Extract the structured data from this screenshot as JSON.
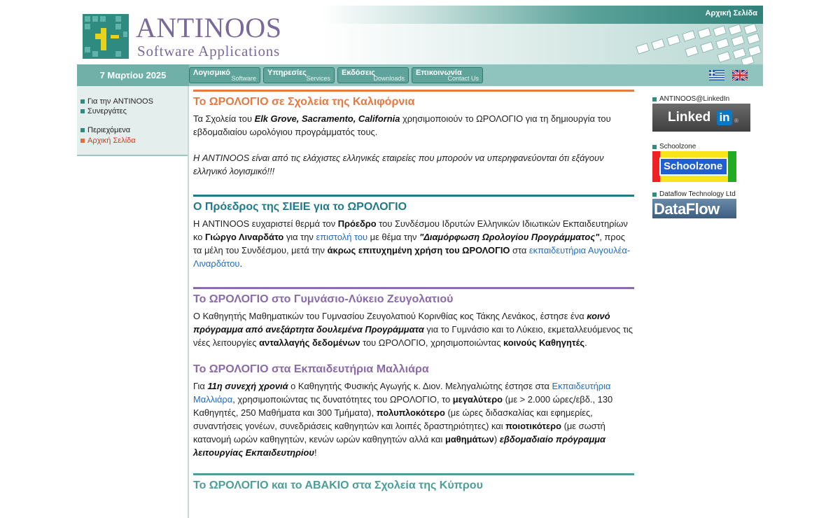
{
  "header": {
    "brand_name": "ANTINOOS",
    "brand_sub": "Software Applications",
    "home_link": "Αρχική Σελίδα"
  },
  "nav": {
    "date": "7 Μαρτίου 2025",
    "items": [
      {
        "gr": "Λογισμικό",
        "en": "Software"
      },
      {
        "gr": "Υπηρεσίες",
        "en": "Services"
      },
      {
        "gr": "Εκδόσεις",
        "en": "Downloads"
      },
      {
        "gr": "Επικοινωνία",
        "en": "Contact Us"
      }
    ]
  },
  "sidebar": {
    "items": [
      {
        "label": "Για την ANTINOOS"
      },
      {
        "label": "Συνεργάτες"
      },
      {
        "label": "Περιεχόμενα"
      },
      {
        "label": "Αρχική Σελίδα"
      }
    ]
  },
  "colors": {
    "orange": "#e37a42",
    "teal_dark": "#1f7a8c",
    "purple": "#8a6aa8",
    "teal": "#4d9e98"
  },
  "sections": {
    "s1": {
      "title": "Το ΩΡΟΛΟΓΙΟ σε Σχολεία της Καλιφόρνια",
      "p1_a": "Τα Σχολεία του ",
      "p1_b": "Elk Grove, Sacramento, California",
      "p1_c": " χρησιμοποιούν το ΩΡΟΛΟΓΙΟ για τη δημιουργία του εβδομαδιαίου ωρολόγιου προγράμματός τους.",
      "p2": "Η ANTINOOS είναι από τις ελάχιστες ελληνικές εταιρείες που μπορούν να υπερηφανεύονται ότι εξάγουν ελληνικό λογισμικό!!!"
    },
    "s2": {
      "title": "Ο Πρόεδρος της ΣΙΕΙΕ για το ΩΡΟΛΟΓΙΟ",
      "a": "Η ANTINOOS ευχαριστεί θερμά τον ",
      "b": "Πρόεδρο",
      "c": " του Συνδέσμου Ιδρυτών Ελληνικών Ιδιωτικών Εκπαιδευτηρίων κο ",
      "d": "Γιώργο Λιναρδάτο",
      "e": " για την ",
      "f": "επιστολή του",
      "g": " με θέμα την ",
      "h": "\"Διαμόρφωση Ωρολογίου Προγράμματος\"",
      "i": ", προς τα μέλη του Συνδέσμου, μετά την ",
      "j": "άκρως επιτυχημένη χρήση του ΩΡΟΛΟΓΙΟ",
      "k": " στα ",
      "l": "εκπαιδευτήρια Αυγουλέα-Λιναρδάτου",
      "m": "."
    },
    "s3": {
      "title": "Το ΩΡΟΛΟΓΙΟ στο Γυμνάσιο-Λύκειο Ζευγολατιού",
      "a": "Ο Καθηγητής Μαθηματικών του Γυμνασίου Ζευγολατιού Κορινθίας κος Τάκης Λενάκος, έστησε ένα ",
      "b": "κοινό πρόγραμμα από ανεξάρτητα δουλεμένα Προγράμματα",
      "c": " για το Γυμνάσιο και το Λύκειο, εκμεταλλευόμενος τις νέες λειτουργίες ",
      "d": "ανταλλαγής δεδομένων",
      "e": " του ΩΡΟΛΟΓΙΟ, χρησιμοποιώντας ",
      "f": "κοινούς Καθηγητές",
      "g": "."
    },
    "s4": {
      "title": "Το ΩΡΟΛΟΓΙΟ στα Εκπαιδευτήρια Μαλλιάρα",
      "a": "Για ",
      "b": "11η συνεχή χρονιά",
      "c": " ο Καθηγητής Φυσικής Αγωγής κ. Διον. Μεληγαλιώτης έστησε στα ",
      "d": "Εκπαιδευτήρια Μαλλιάρα",
      "e": ", χρησιμοποιώντας τις δυνατότητες του ΩΡΟΛΟΓΙΟ, το ",
      "f": "μεγαλύτερο",
      "g": " (με > 2.000 ώρες/εβδ., 130 Καθηγητές, 250 Μαθήματα και 300 Τμήματα), ",
      "h": "πολυπλοκότερο",
      "i": " (με ώρες διδασκαλίας και εφημερίες, συναντήσεις γονέων, συνεδριάσεις καθηγητών και λοιπές δραστηριότητες) και ",
      "j": "ποιοτικότερο",
      "k": " (με σωστή κατανομή ωρών καθηγητών, κενών ωρών καθηγητών αλλά και ",
      "l": "μαθημάτων",
      "m": ") ",
      "n": "εβδομαδιαίο πρόγραμμα λειτουργίας Εκπαιδευτηρίου",
      "o": "!"
    },
    "s5": {
      "title": "Το ΩΡΟΛΟΓΙΟ και το ΑΒΑΚΙΟ στα Σχολεία της Κύπρου"
    }
  },
  "right": {
    "linkedin_label": "ANTINOOS@LinkedIn",
    "linkedin_word": "Linked",
    "linkedin_in": "in",
    "schoolzone_label": "Schoolzone",
    "schoolzone_word": "Schoolzone",
    "dataflow_label": "Dataflow Technology Ltd",
    "dataflow_word": "DataFlow"
  }
}
